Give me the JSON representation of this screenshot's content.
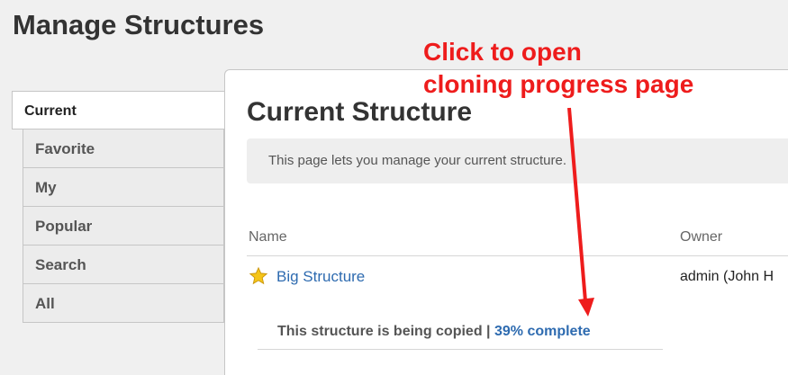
{
  "page_title": "Manage Structures",
  "sidebar": {
    "items": [
      {
        "label": "Current",
        "active": true
      },
      {
        "label": "Favorite"
      },
      {
        "label": "My"
      },
      {
        "label": "Popular"
      },
      {
        "label": "Search"
      },
      {
        "label": "All"
      }
    ]
  },
  "main": {
    "title": "Current Structure",
    "info": "This page lets you manage your current structure.",
    "columns": {
      "name": "Name",
      "owner": "Owner"
    },
    "row": {
      "name": "Big Structure",
      "owner": "admin (John H",
      "progress_text": "This structure is being copied | ",
      "progress_link": "39% complete"
    }
  },
  "annotation": {
    "line1": "Click to open",
    "line2": "cloning progress page",
    "color": "#ee1c1c"
  },
  "colors": {
    "link": "#2e6bb0",
    "star": "#f5c518"
  }
}
